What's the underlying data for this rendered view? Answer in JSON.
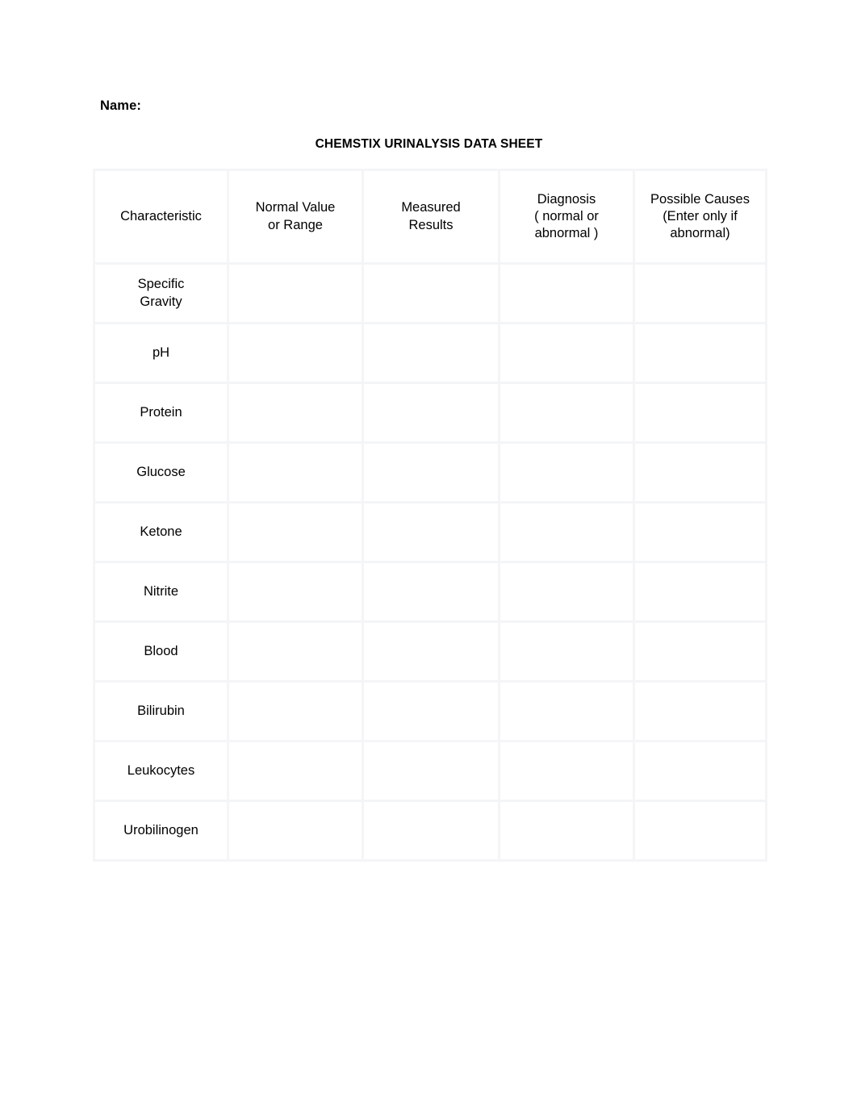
{
  "document": {
    "name_label": "Name:",
    "title": "CHEMSTIX URINALYSIS DATA SHEET"
  },
  "table": {
    "header_fill": "#d9e2ec",
    "grid_color": "#f4f5f7",
    "columns": [
      {
        "id": "characteristic",
        "lines": [
          "Characteristic"
        ]
      },
      {
        "id": "normal_value_or_range",
        "lines": [
          "Normal Value",
          "or Range"
        ]
      },
      {
        "id": "measured_results",
        "lines": [
          "Measured",
          "Results"
        ]
      },
      {
        "id": "diagnosis",
        "lines": [
          "Diagnosis",
          "( normal or",
          "abnormal )"
        ]
      },
      {
        "id": "possible_causes",
        "lines": [
          "Possible Causes",
          "(Enter only if",
          "abnormal)"
        ]
      }
    ],
    "rows": [
      {
        "characteristic_lines": [
          "Specific",
          "Gravity"
        ],
        "normal_value": "",
        "measured_results": "",
        "diagnosis": "",
        "possible_causes": ""
      },
      {
        "characteristic_lines": [
          "pH"
        ],
        "normal_value": "",
        "measured_results": "",
        "diagnosis": "",
        "possible_causes": ""
      },
      {
        "characteristic_lines": [
          "Protein"
        ],
        "normal_value": "",
        "measured_results": "",
        "diagnosis": "",
        "possible_causes": ""
      },
      {
        "characteristic_lines": [
          "Glucose"
        ],
        "normal_value": "",
        "measured_results": "",
        "diagnosis": "",
        "possible_causes": ""
      },
      {
        "characteristic_lines": [
          "Ketone"
        ],
        "normal_value": "",
        "measured_results": "",
        "diagnosis": "",
        "possible_causes": ""
      },
      {
        "characteristic_lines": [
          "Nitrite"
        ],
        "normal_value": "",
        "measured_results": "",
        "diagnosis": "",
        "possible_causes": ""
      },
      {
        "characteristic_lines": [
          "Blood"
        ],
        "normal_value": "",
        "measured_results": "",
        "diagnosis": "",
        "possible_causes": ""
      },
      {
        "characteristic_lines": [
          "Bilirubin"
        ],
        "normal_value": "",
        "measured_results": "",
        "diagnosis": "",
        "possible_causes": ""
      },
      {
        "characteristic_lines": [
          "Leukocytes"
        ],
        "normal_value": "",
        "measured_results": "",
        "diagnosis": "",
        "possible_causes": ""
      },
      {
        "characteristic_lines": [
          "Urobilinogen"
        ],
        "normal_value": "",
        "measured_results": "",
        "diagnosis": "",
        "possible_causes": ""
      }
    ]
  }
}
